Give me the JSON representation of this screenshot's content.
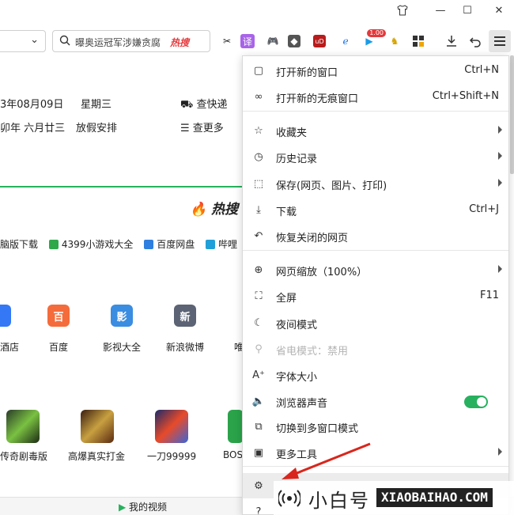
{
  "window": {
    "tshirt_icon": "tshirt-icon",
    "minimize": "—",
    "maximize": "☐",
    "close": "✕"
  },
  "toolbar": {
    "search_text": "曝奥运冠军涉嫌贪腐",
    "hot_label": "热搜",
    "badge_count": "1.00"
  },
  "content": {
    "date": "3年08月09日",
    "weekday": "星期三",
    "lunar": "卯年 六月廿三",
    "holiday": "放假安排",
    "express": "查快递",
    "more": "查更多",
    "hot_title": "热搜",
    "nav_links": [
      "脑版下载",
      "4399小游戏大全",
      "百度网盘",
      "哔哩"
    ],
    "apps": [
      {
        "glyph": "",
        "label": "酒店",
        "color": "#3478f6"
      },
      {
        "glyph": "百",
        "label": "百度",
        "color": "#f46c3b"
      },
      {
        "glyph": "影",
        "label": "影视大全",
        "color": "#3a8de0"
      },
      {
        "glyph": "新",
        "label": "新浪微博",
        "color": "#5b6374"
      },
      {
        "glyph": "",
        "label": "唯",
        "color": "#ffffff"
      }
    ],
    "games": [
      {
        "label": "传奇剧毒版"
      },
      {
        "label": "高爆真实打金"
      },
      {
        "label": "一刀99999"
      },
      {
        "label": "BOS"
      }
    ],
    "my_video": "我的视频"
  },
  "menu": {
    "items": [
      {
        "icon": "new-window-icon",
        "glyph": "▢",
        "label": "打开新的窗口",
        "shortcut": "Ctrl+N",
        "arrow": false
      },
      {
        "icon": "incognito-icon",
        "glyph": "∞",
        "label": "打开新的无痕窗口",
        "shortcut": "Ctrl+Shift+N",
        "arrow": false
      },
      {
        "icon": "star-icon",
        "glyph": "☆",
        "label": "收藏夹",
        "shortcut": "",
        "arrow": true
      },
      {
        "icon": "history-icon",
        "glyph": "◷",
        "label": "历史记录",
        "shortcut": "",
        "arrow": true
      },
      {
        "icon": "save-icon",
        "glyph": "⬚",
        "label": "保存(网页、图片、打印)",
        "shortcut": "",
        "arrow": true
      },
      {
        "icon": "download-icon",
        "glyph": "⤓",
        "label": "下载",
        "shortcut": "Ctrl+J",
        "arrow": false
      },
      {
        "icon": "restore-icon",
        "glyph": "↶",
        "label": "恢复关闭的网页",
        "shortcut": "",
        "arrow": false
      },
      {
        "icon": "zoom-icon",
        "glyph": "⊕",
        "label": "网页缩放（100%）",
        "shortcut": "",
        "arrow": true
      },
      {
        "icon": "fullscreen-icon",
        "glyph": "⛶",
        "label": "全屏",
        "shortcut": "F11",
        "arrow": false
      },
      {
        "icon": "night-mode-icon",
        "glyph": "☾",
        "label": "夜间模式",
        "shortcut": "",
        "arrow": false
      },
      {
        "icon": "power-save-icon",
        "glyph": "⚲",
        "label": "省电模式：禁用",
        "shortcut": "",
        "arrow": false,
        "disabled": true
      },
      {
        "icon": "font-size-icon",
        "glyph": "A⁺",
        "label": "字体大小",
        "shortcut": "",
        "arrow": false
      },
      {
        "icon": "sound-icon",
        "glyph": "🔈",
        "label": "浏览器声音",
        "shortcut": "",
        "arrow": false,
        "toggle": true
      },
      {
        "icon": "multi-window-icon",
        "glyph": "⧉",
        "label": "切换到多窗口模式",
        "shortcut": "",
        "arrow": false
      },
      {
        "icon": "toolbox-icon",
        "glyph": "▣",
        "label": "更多工具",
        "shortcut": "",
        "arrow": true
      },
      {
        "icon": "settings-icon",
        "glyph": "⚙",
        "label": "",
        "shortcut": "",
        "arrow": false,
        "hover": true
      },
      {
        "icon": "help-icon",
        "glyph": "?",
        "label": "",
        "shortcut": "",
        "arrow": false
      }
    ]
  },
  "watermark": {
    "cn": "小白号",
    "en": "XIAOBAIHAO.COM"
  },
  "colors": {
    "accent_green": "#27b15e",
    "arrow_red": "#d9261c",
    "hot_red": "#e4393c"
  }
}
